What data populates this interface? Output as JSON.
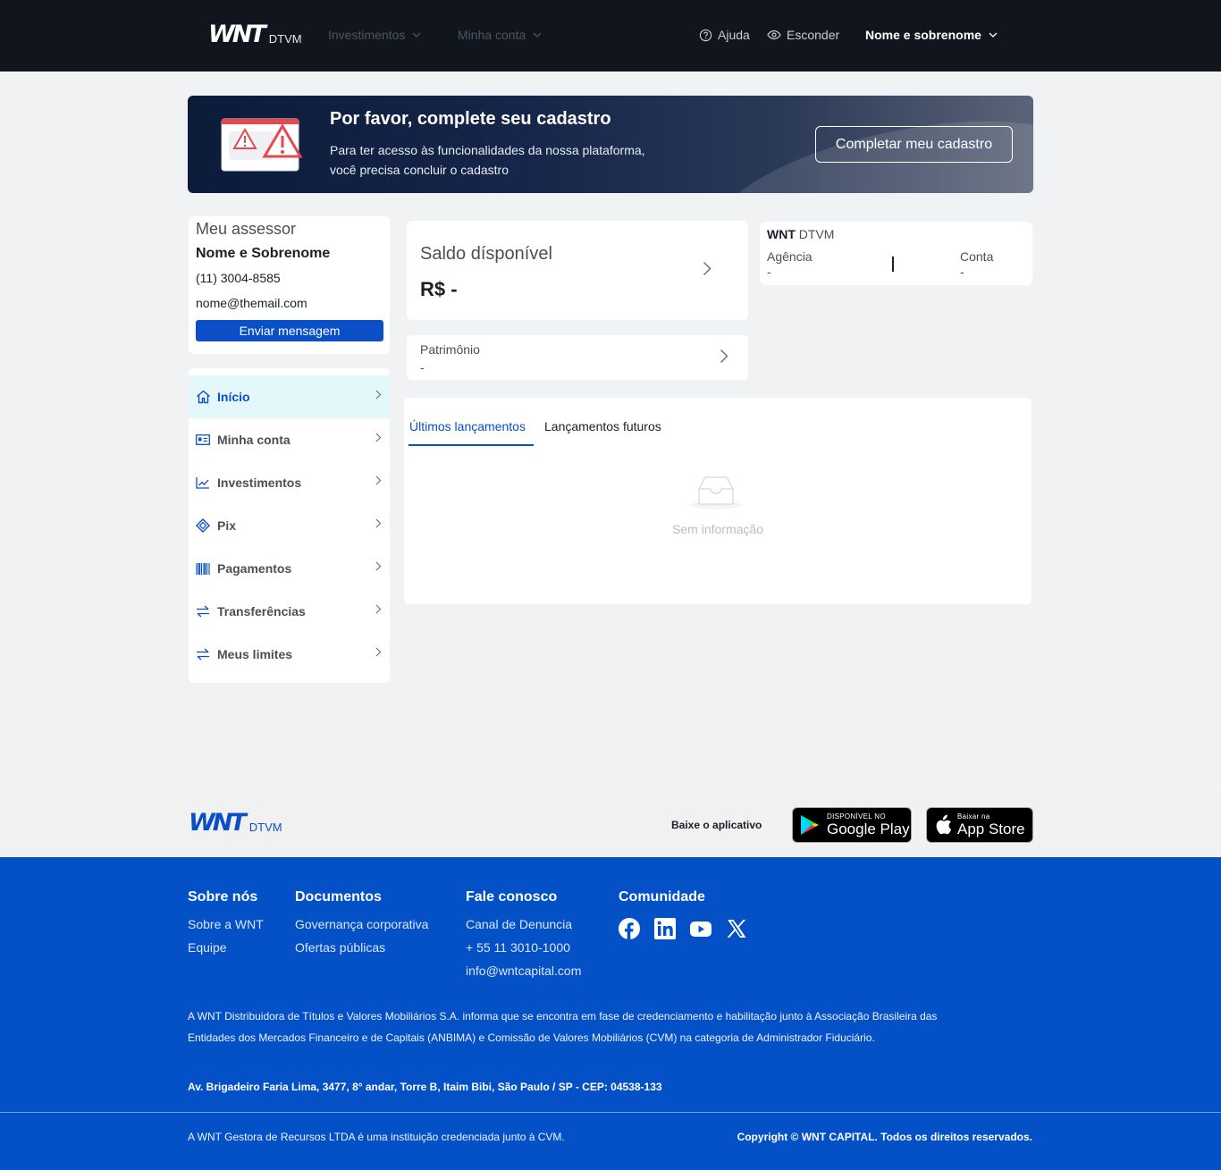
{
  "header": {
    "logo_mark": "WNT",
    "logo_sub": "DTVM",
    "nav": [
      {
        "label": "Investimentos"
      },
      {
        "label": "Minha conta"
      }
    ],
    "help_label": "Ajuda",
    "hide_label": "Esconder",
    "user_name": "Nome e sobrenome"
  },
  "banner": {
    "title": "Por favor, complete seu cadastro",
    "text_line1": "Para ter acesso às funcionalidades da nossa plataforma,",
    "text_line2": "você precisa concluir o cadastro",
    "button_label": "Completar meu cadastro"
  },
  "advisor": {
    "heading": "Meu assessor",
    "name": "Nome e Sobrenome",
    "phone": "(11) 3004-8585",
    "email": "nome@themail.com",
    "button_label": "Enviar mensagem"
  },
  "sidebar": {
    "items": [
      {
        "label": "Início",
        "icon": "home-icon",
        "active": true
      },
      {
        "label": "Minha conta",
        "icon": "id-card-icon"
      },
      {
        "label": "Investimentos",
        "icon": "chart-line-icon"
      },
      {
        "label": "Pix",
        "icon": "pix-icon"
      },
      {
        "label": "Pagamentos",
        "icon": "barcode-icon"
      },
      {
        "label": "Transferências",
        "icon": "transfer-icon"
      },
      {
        "label": "Meus limites",
        "icon": "transfer-icon"
      }
    ]
  },
  "balance": {
    "label": "Saldo dísponível",
    "value": "R$ -"
  },
  "patrimony": {
    "label": "Patrimônio",
    "value": "-"
  },
  "account": {
    "bank_bold": "WNT",
    "bank_rest": " DTVM",
    "agency_label": "Agência",
    "agency_value": "-",
    "account_label": "Conta",
    "account_value": "-"
  },
  "ghost_button_label": "Completar meu cadastro",
  "transactions": {
    "tabs": [
      "Últimos lançamentos",
      "Lançamentos futuros"
    ],
    "empty_text": "Sem informação"
  },
  "footer_top": {
    "logo_mark": "WNT",
    "logo_sub": "DTVM",
    "download_label": "Baixe o aplicativo",
    "google_small": "DISPONÍVEL NO",
    "google_big": "Google Play",
    "apple_small": "Baixar na",
    "apple_big": "App Store"
  },
  "footer": {
    "about": {
      "heading": "Sobre nós",
      "links": [
        "Sobre a WNT",
        "Equipe"
      ]
    },
    "documents": {
      "heading": "Documentos",
      "links": [
        "Governança corporativa",
        "Ofertas públicas"
      ]
    },
    "contact": {
      "heading": "Fale conosco",
      "links": [
        "Canal de Denuncia",
        "+ 55 11 3010-1000",
        "info@wntcapital.com"
      ]
    },
    "community": {
      "heading": "Comunidade",
      "icons": [
        "facebook-icon",
        "linkedin-icon",
        "youtube-icon",
        "x-icon"
      ]
    },
    "legal_line1": "A WNT Distribuidora de Títulos e Valores Mobiliários S.A. informa que se encontra em fase de credenciamento e habilitação junto à Associação Brasileira das",
    "legal_line2": "Entidades dos Mercados Financeiro e de Capitais (ANBIMA) e Comissão de Valores Mobiliários (CVM) na categoria de Administrador Fiduciário.",
    "address": "Av. Brigadeiro Faria Lima, 3477, 8° andar, Torre B, Itaim Bibi, São Paulo / SP - CEP: 04538-133",
    "bottom_left": "A WNT Gestora de Recursos LTDA é uma instituição credenciada junto à CVM.",
    "copyright": "Copyright © WNT CAPITAL. Todos os direitos reservados."
  },
  "colors": {
    "brand_blue": "#0a4fc7",
    "header_bg": "#11151d",
    "footer_bg": "#0451c7",
    "active_bg": "#e4f8fc"
  }
}
